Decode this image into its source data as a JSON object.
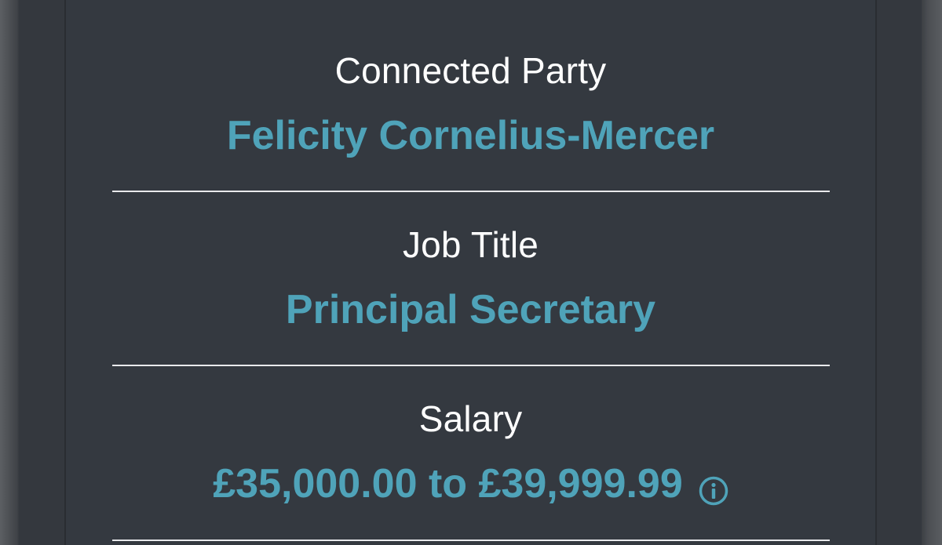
{
  "fields": [
    {
      "label": "Connected Party",
      "value": "Felicity Cornelius-Mercer"
    },
    {
      "label": "Job Title",
      "value": "Principal Secretary"
    },
    {
      "label": "Salary",
      "value": "£35,000.00 to £39,999.99"
    }
  ],
  "colors": {
    "background": "#343940",
    "label": "#ffffff",
    "accent": "#4fa3b9",
    "divider": "#e9eaec"
  },
  "icons": {
    "salary_info": "info-circle-icon"
  }
}
